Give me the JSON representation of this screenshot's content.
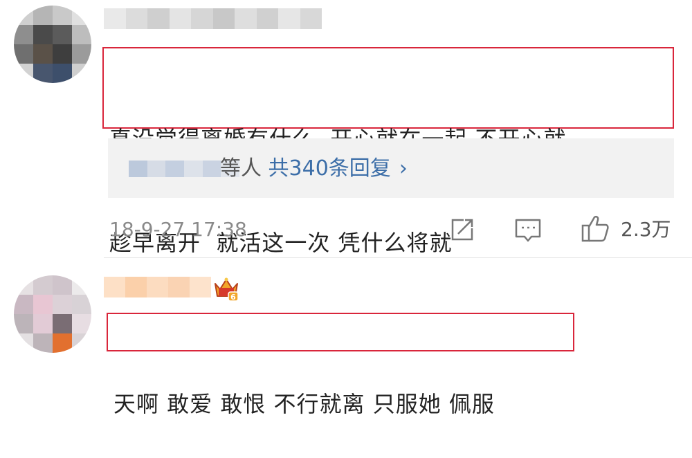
{
  "comments": [
    {
      "text_line1": "真没觉得离婚有什么  开心就在一起 不开心就",
      "text_line2": "趁早离开  就活这一次 凭什么将就",
      "reply_summary": {
        "prefix": "等人 ",
        "link_text": "共340条回复",
        "chevron": "›"
      },
      "timestamp": "18-9-27 17:38",
      "like_count": "2.3万"
    },
    {
      "text_line1": "天啊 敢爱 敢恨 不行就离 只服她 佩服",
      "badge": "6"
    }
  ],
  "colors": {
    "highlight_border": "#d9263b",
    "link": "#3c6ea8",
    "meta_gray": "#8a8a8a",
    "card_bg": "#f2f2f2"
  },
  "icons": [
    "share-icon",
    "comment-icon",
    "like-icon",
    "crown-icon"
  ]
}
